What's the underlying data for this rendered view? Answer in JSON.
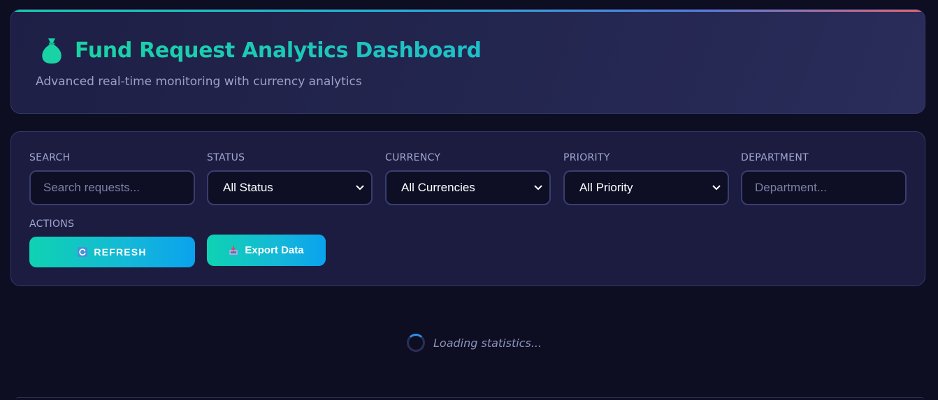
{
  "header": {
    "icon": "money-bag-icon",
    "title": "Fund Request Analytics Dashboard",
    "subtitle": "Advanced real-time monitoring with currency analytics"
  },
  "filters": {
    "search": {
      "label": "SEARCH",
      "placeholder": "Search requests..."
    },
    "status": {
      "label": "STATUS",
      "value": "All Status"
    },
    "currency": {
      "label": "CURRENCY",
      "value": "All Currencies"
    },
    "priority": {
      "label": "PRIORITY",
      "value": "All Priority"
    },
    "department": {
      "label": "DEPARTMENT",
      "placeholder": "Department..."
    },
    "actions": {
      "label": "ACTIONS",
      "refresh": {
        "icon": "refresh-icon",
        "label": "REFRESH"
      },
      "export": {
        "icon": "inbox-tray-icon",
        "label": "Export Data"
      }
    }
  },
  "loading": {
    "text": "Loading statistics..."
  },
  "colors": {
    "accent": "#19d3a4",
    "background": "#0d0e22",
    "card": "#1b1c40",
    "button_start": "#0fd2b2",
    "button_end": "#0aa2ee"
  }
}
